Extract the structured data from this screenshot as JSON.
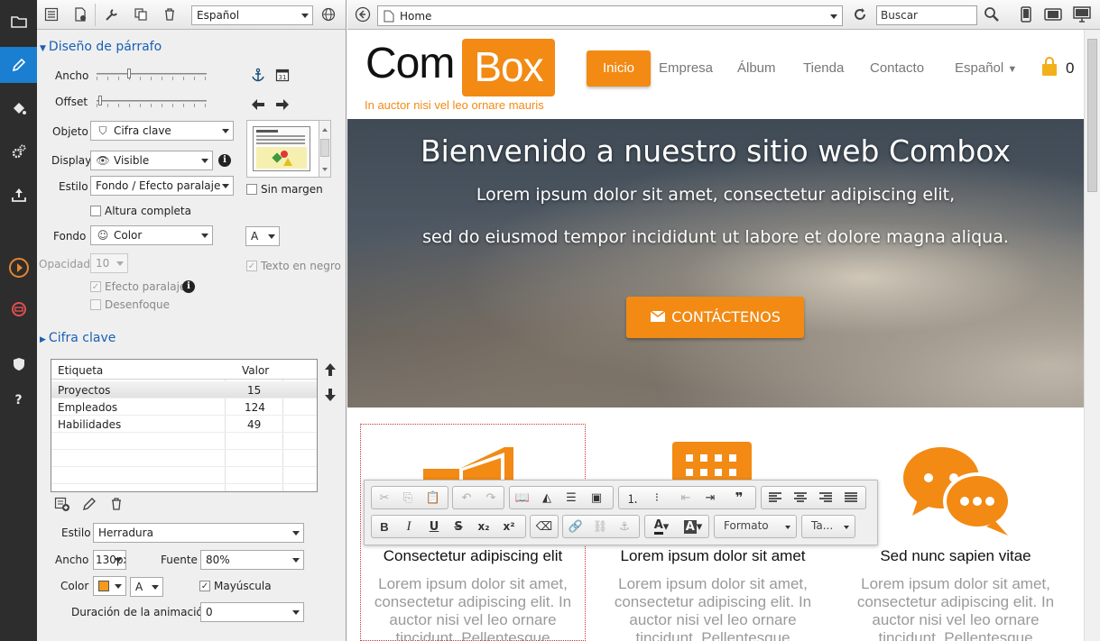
{
  "panel": {
    "language": "Español",
    "section1": "Diseño de párrafo",
    "ancho_label": "Ancho",
    "offset_label": "Offset",
    "objeto_label": "Objeto",
    "objeto_value": "Cifra clave",
    "display_label": "Display",
    "display_value": "Visible",
    "estilo_label": "Estilo",
    "estilo_value": "Fondo / Efecto paralaje",
    "sin_margen": "Sin margen",
    "altura_completa": "Altura completa",
    "fondo_label": "Fondo",
    "fondo_value": "Color",
    "font_letter": "A",
    "opacidad_label": "Opacidad",
    "opacidad_value": "10",
    "texto_en_negro": "Texto en negro",
    "efecto_paralaje": "Efecto paralaje",
    "desenfoque": "Desenfoque",
    "section2": "Cifra clave",
    "table": {
      "col_label": "Etiqueta",
      "col_value": "Valor",
      "rows": [
        {
          "label": "Proyectos",
          "value": "15"
        },
        {
          "label": "Empleados",
          "value": "124"
        },
        {
          "label": "Habilidades",
          "value": "49"
        }
      ]
    },
    "estilo2_label": "Estilo",
    "estilo2_value": "Herradura",
    "ancho2_label": "Ancho",
    "ancho2_value": "130px",
    "fuente_label": "Fuente",
    "fuente_value": "80%",
    "color_label": "Color",
    "color_letter": "A",
    "mayuscula": "Mayúscula",
    "duracion_label": "Duración de la animación",
    "duracion_value": "0",
    "calendar_day": "31",
    "accent_color": "#f39a1b"
  },
  "browser": {
    "url": "Home",
    "search_placeholder": "Buscar"
  },
  "site": {
    "logo_left": "Com",
    "logo_right": "Box",
    "tagline": "In auctor nisi vel leo ornare mauris",
    "nav": [
      "Inicio",
      "Empresa",
      "Álbum",
      "Tienda",
      "Contacto",
      "Español"
    ],
    "cart_count": "0",
    "hero_title": "Bienvenido a nuestro sitio web Combox",
    "hero_line1": "Lorem ipsum dolor sit amet, consectetur adipiscing elit,",
    "hero_line2": "sed do eiusmod tempor incididunt ut labore et dolore magna aliqua.",
    "cta": "CONTÁCTENOS",
    "features": [
      {
        "title": "Consectetur adipiscing elit",
        "text": "Lorem ipsum dolor sit amet, consectetur adipiscing elit. In auctor nisi vel leo ornare tincidunt. Pellentesque"
      },
      {
        "title": "Lorem ipsum dolor sit amet",
        "text": "Lorem ipsum dolor sit amet, consectetur adipiscing elit. In auctor nisi vel leo ornare tincidunt. Pellentesque"
      },
      {
        "title": "Sed nunc sapien vitae",
        "text": "Lorem ipsum dolor sit amet, consectetur adipiscing elit. In auctor nisi vel leo ornare tincidunt. Pellentesque"
      }
    ],
    "brand_color": "#f28a14"
  },
  "editor": {
    "format_label": "Formato",
    "size_label": "Ta...",
    "font_color_letter": "A",
    "bg_color_letter": "A",
    "quote_glyph": "❞",
    "bold": "B",
    "italic": "I",
    "underline": "U",
    "strike": "S",
    "subscript": "x₂",
    "superscript": "x²"
  }
}
